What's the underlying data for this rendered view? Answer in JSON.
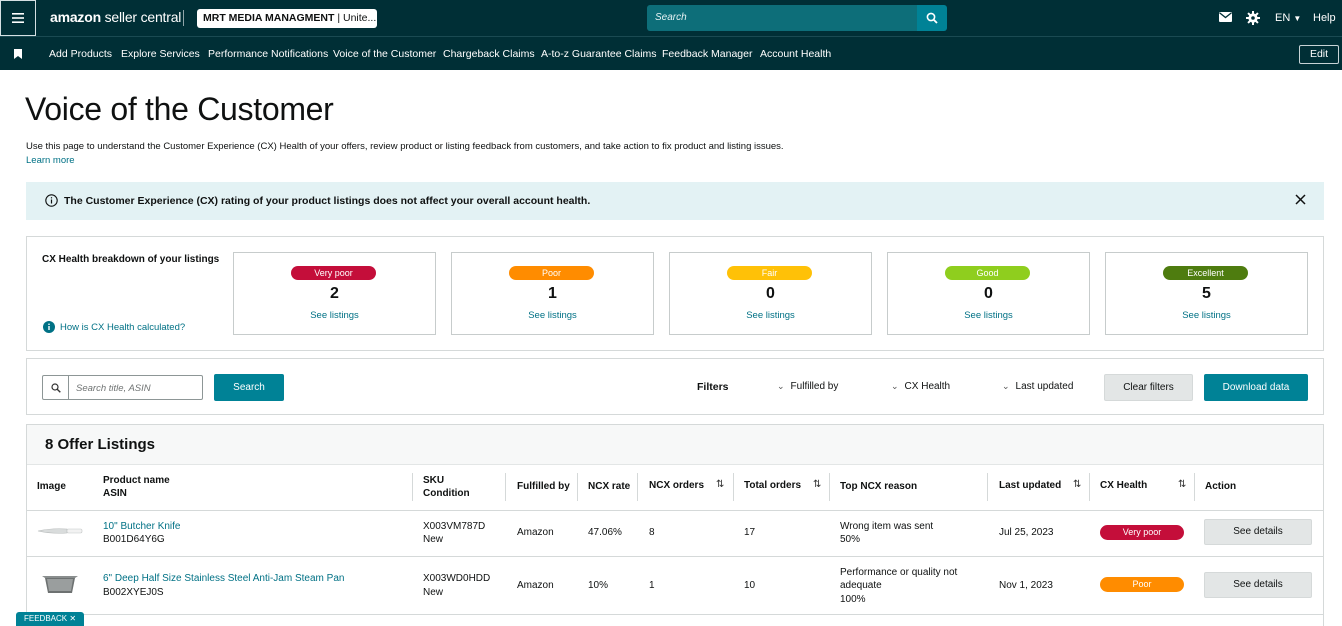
{
  "topbar": {
    "logo_brand": "amazon",
    "logo_product": " seller central",
    "store_selector": {
      "name": "MRT MEDIA MANAGMENT",
      "suffix": " | Unite..."
    },
    "search_placeholder": "Search",
    "language": "EN",
    "help_label": "Help"
  },
  "nav": {
    "items": [
      "Add Products",
      "Explore Services",
      "Performance Notifications",
      "Voice of the Customer",
      "Chargeback Claims",
      "A-to-z Guarantee Claims",
      "Feedback Manager",
      "Account Health"
    ],
    "edit_label": "Edit"
  },
  "page": {
    "title": "Voice of the Customer",
    "description": "Use this page to understand the Customer Experience (CX) Health of your offers, review product or listing feedback from customers, and take action to fix product and listing issues.",
    "learn_more": "Learn more"
  },
  "banner": {
    "text": "The Customer Experience (CX) rating of your product listings does not affect your overall account health."
  },
  "breakdown": {
    "title": "CX Health breakdown of your listings",
    "help_link": "How is CX Health calculated?",
    "see_listings_label": "See listings",
    "boxes": [
      {
        "label": "Very poor",
        "count": "2",
        "color": "#c40e3a"
      },
      {
        "label": "Poor",
        "count": "1",
        "color": "#ff8c00"
      },
      {
        "label": "Fair",
        "count": "0",
        "color": "#ffc107"
      },
      {
        "label": "Good",
        "count": "0",
        "color": "#8fce1e"
      },
      {
        "label": "Excellent",
        "count": "5",
        "color": "#4e7c0f"
      }
    ]
  },
  "filters": {
    "search_placeholder": "Search title, ASIN",
    "search_button": "Search",
    "filters_label": "Filters",
    "dropdowns": [
      "Fulfilled by",
      "CX Health",
      "Last updated"
    ],
    "clear_button": "Clear filters",
    "download_button": "Download data"
  },
  "listings": {
    "title": "8 Offer Listings",
    "columns": {
      "image": "Image",
      "product_name": "Product name",
      "asin": "ASIN",
      "sku": "SKU",
      "condition": "Condition",
      "fulfilled_by": "Fulfilled by",
      "ncx_rate": "NCX rate",
      "ncx_orders": "NCX orders",
      "total_orders": "Total orders",
      "top_reason": "Top NCX reason",
      "last_updated": "Last updated",
      "cx_health": "CX Health",
      "action": "Action"
    },
    "rows": [
      {
        "product_name": "10\" Butcher Knife",
        "asin": "B001D64Y6G",
        "sku": "X003VM787D",
        "condition": "New",
        "fulfilled_by": "Amazon",
        "ncx_rate": "47.06%",
        "ncx_orders": "8",
        "total_orders": "17",
        "reason_line1": "Wrong item was sent",
        "reason_line2": "",
        "reason_pct": "50%",
        "last_updated": "Jul 25, 2023",
        "health": "Very poor",
        "health_color": "#c40e3a",
        "action": "See details"
      },
      {
        "product_name": "6\" Deep Half Size Stainless Steel Anti-Jam Steam Pan",
        "asin": "B002XYEJ0S",
        "sku": "X003WD0HDD",
        "condition": "New",
        "fulfilled_by": "Amazon",
        "ncx_rate": "10%",
        "ncx_orders": "1",
        "total_orders": "10",
        "reason_line1": "Performance or quality not",
        "reason_line2": "adequate",
        "reason_pct": "100%",
        "last_updated": "Nov 1, 2023",
        "health": "Poor",
        "health_color": "#ff8c00",
        "action": "See details"
      }
    ]
  },
  "feedback_tab": "FEEDBACK"
}
